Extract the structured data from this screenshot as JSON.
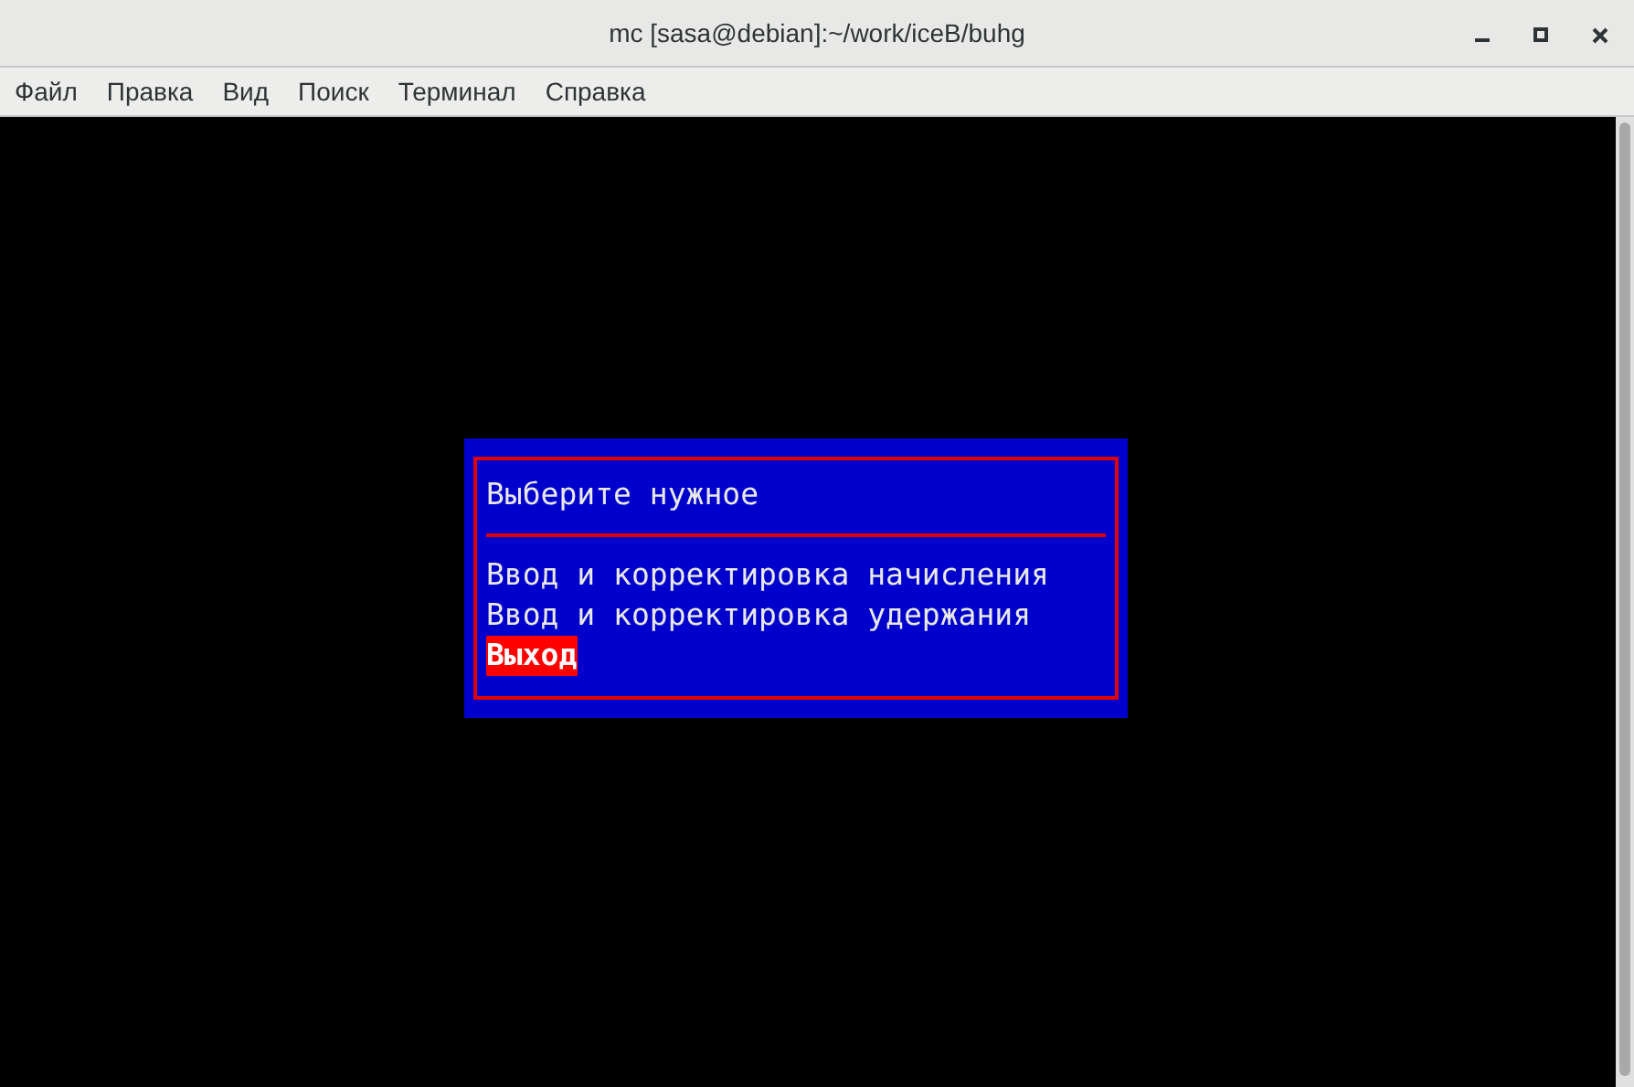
{
  "window": {
    "title": "mc [sasa@debian]:~/work/iceB/buhg"
  },
  "menu": [
    "Файл",
    "Правка",
    "Вид",
    "Поиск",
    "Терминал",
    "Справка"
  ],
  "dialog": {
    "title": "Выберите нужное",
    "items": [
      {
        "label": "Ввод и корректировка начисления",
        "selected": false
      },
      {
        "label": "Ввод и корректировка удержания",
        "selected": false
      },
      {
        "label": "Выход",
        "selected": true
      }
    ]
  }
}
